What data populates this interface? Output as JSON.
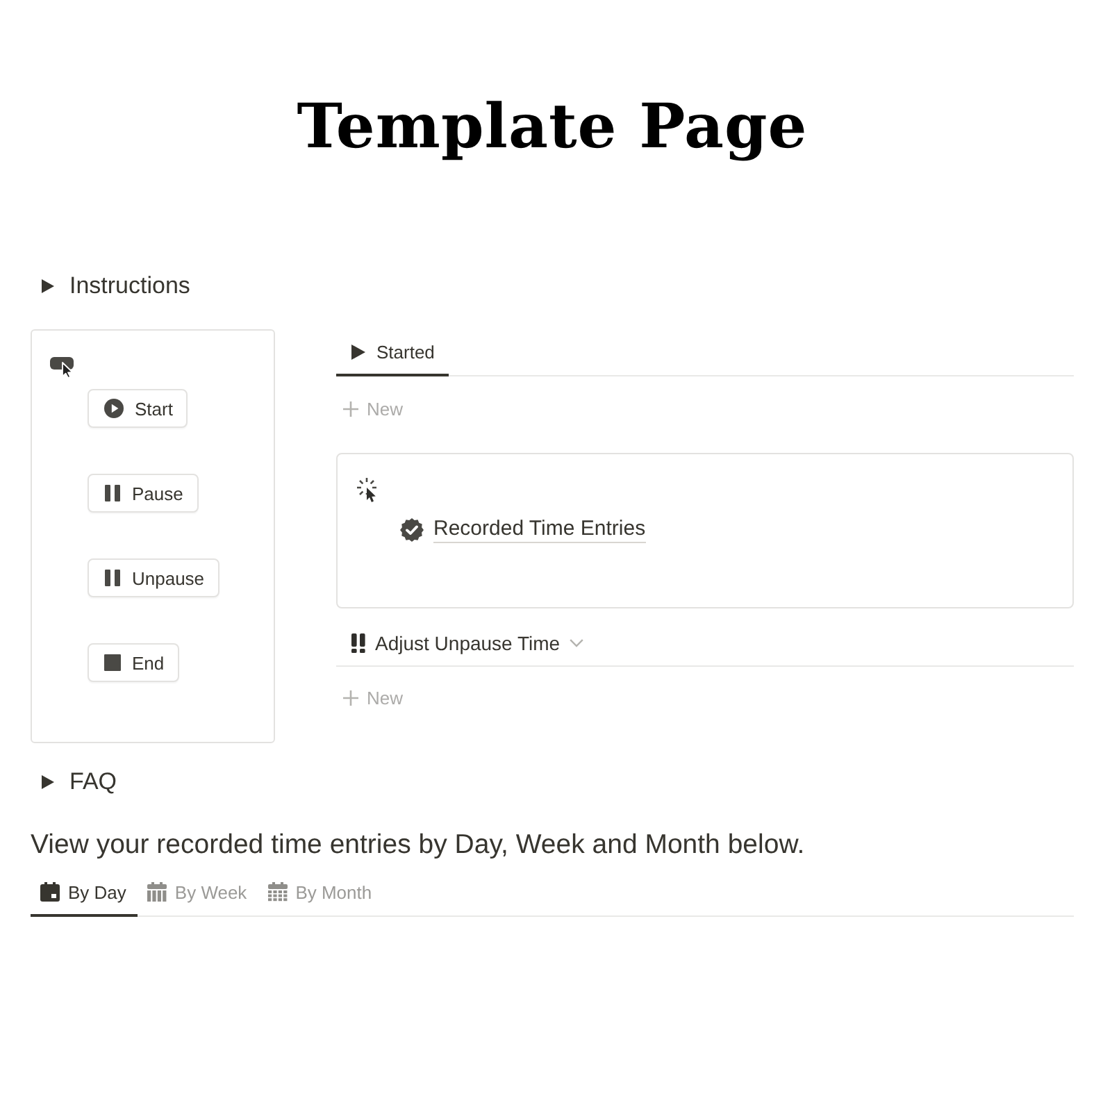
{
  "title": "Template Page",
  "instructions_toggle": {
    "label": "Instructions",
    "expanded": false
  },
  "button_panel": {
    "buttons": [
      {
        "label": "Start",
        "kind": "play"
      },
      {
        "label": "Pause",
        "kind": "pause"
      },
      {
        "label": "Unpause",
        "kind": "pause"
      },
      {
        "label": "End",
        "kind": "stop"
      }
    ]
  },
  "started_view": {
    "tabs": [
      {
        "label": "Started",
        "selected": true
      }
    ],
    "new_label": "New"
  },
  "linked_card": {
    "title": "Recorded Time Entries"
  },
  "unpause_group": {
    "label": "Adjust Unpause Time",
    "new_label": "New"
  },
  "faq_toggle": {
    "label": "FAQ",
    "expanded": false
  },
  "description": "View your recorded time entries by Day, Week and Month below.",
  "calendar_tabs": [
    {
      "label": "By Day",
      "kind": "day",
      "selected": true
    },
    {
      "label": "By Week",
      "kind": "week",
      "selected": false
    },
    {
      "label": "By Month",
      "kind": "month",
      "selected": false
    }
  ]
}
